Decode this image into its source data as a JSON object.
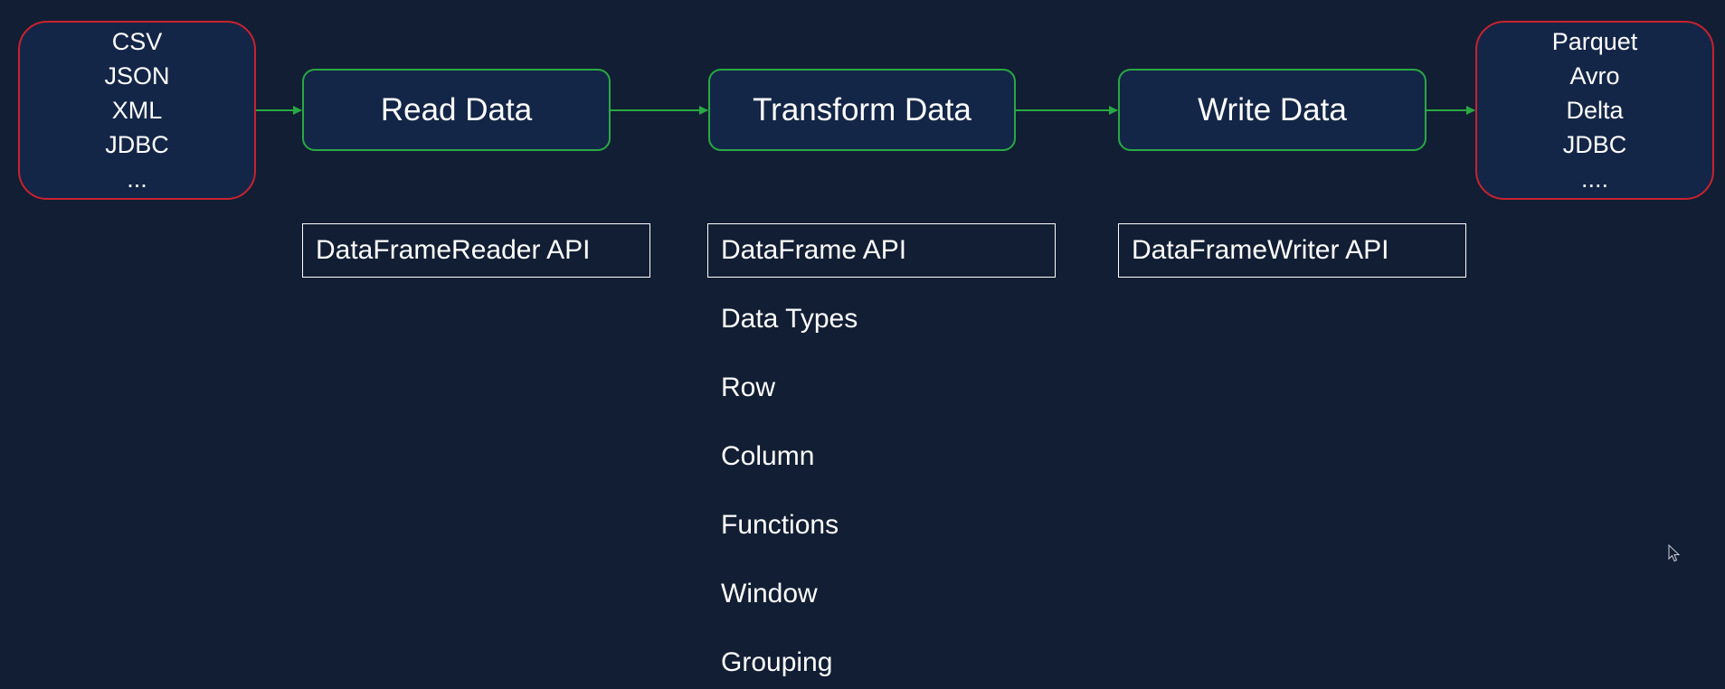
{
  "sources": {
    "items": [
      "CSV",
      "JSON",
      "XML",
      "JDBC",
      "..."
    ]
  },
  "steps": {
    "read": "Read Data",
    "transform": "Transform Data",
    "write": "Write Data"
  },
  "sinks": {
    "items": [
      "Parquet",
      "Avro",
      "Delta",
      "JDBC",
      "...."
    ]
  },
  "apis": {
    "reader": "DataFrameReader API",
    "dataframe": "DataFrame API",
    "writer": "DataFrameWriter API"
  },
  "transform_topics": [
    "Data Types",
    "Row",
    "Column",
    "Functions",
    "Window",
    "Grouping"
  ],
  "colors": {
    "background": "#121e33",
    "box_fill": "#142647",
    "source_border": "#c8222f",
    "step_border": "#29a843",
    "arrow": "#29a843",
    "text": "#ffffff"
  }
}
